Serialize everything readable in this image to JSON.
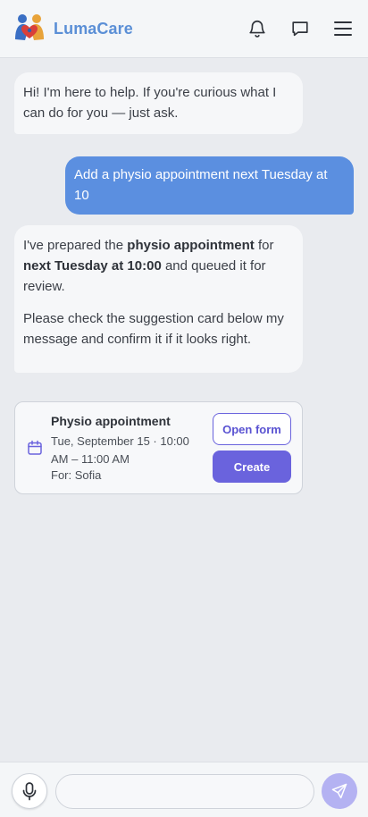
{
  "header": {
    "brand": "LumaCare",
    "icons": [
      "family-logo-icon",
      "bell-icon",
      "chat-icon",
      "menu-icon"
    ]
  },
  "messages": [
    {
      "role": "assistant",
      "paragraphs": [
        [
          {
            "text": "Hi! I'm here to help. If you're curious what I can do for you — just ask."
          }
        ]
      ]
    },
    {
      "role": "user",
      "text": "Add a physio appointment next Tuesday at 10"
    },
    {
      "role": "assistant",
      "paragraphs": [
        [
          {
            "text": "I've prepared the "
          },
          {
            "text": "physio appointment",
            "bold": true
          },
          {
            "text": " for "
          },
          {
            "text": "next Tuesday at 10:00",
            "bold": true
          },
          {
            "text": " and queued it for review."
          }
        ],
        [
          {
            "text": "Please check the suggestion card below my message and confirm it if it looks right."
          }
        ]
      ]
    }
  ],
  "suggestion_card": {
    "icon": "calendar-icon",
    "title": "Physio appointment",
    "when": "Tue, September 15 · 10:00 AM – 11:00 AM",
    "for": "For: Sofia",
    "open_label": "Open form",
    "create_label": "Create"
  },
  "composer": {
    "value": "",
    "placeholder": "",
    "icons": [
      "microphone-icon",
      "send-icon"
    ]
  },
  "colors": {
    "brand": "#5b8fd6",
    "user_bubble": "#5b8fe0",
    "accent": "#6a63dd",
    "send_disabled": "#b4b2f2"
  }
}
